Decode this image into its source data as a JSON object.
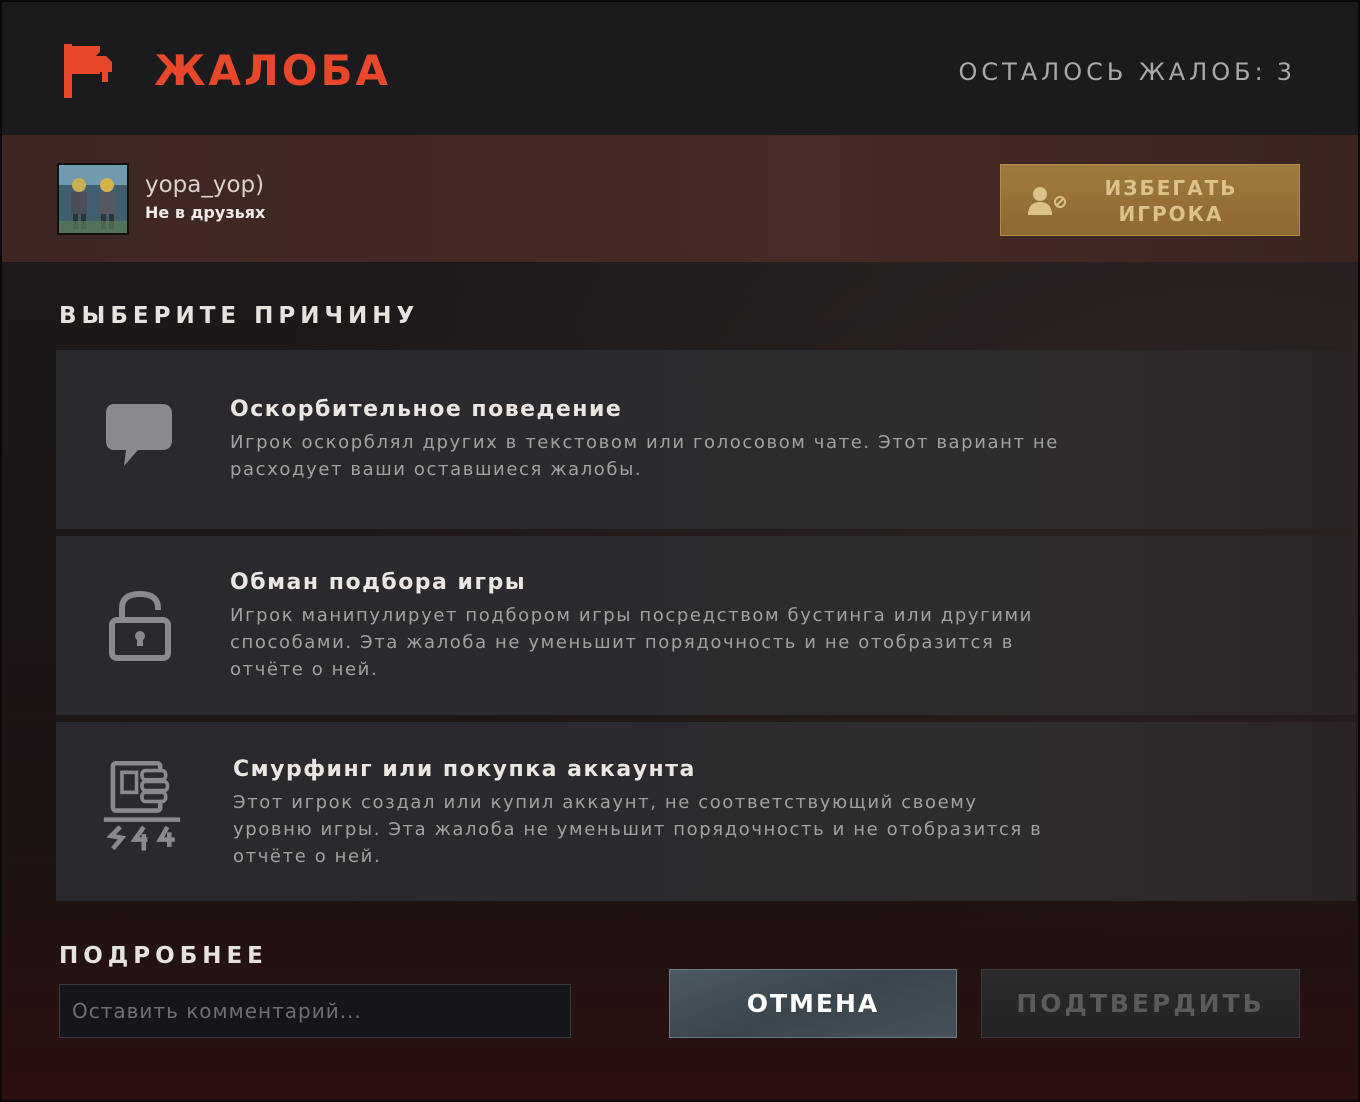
{
  "header": {
    "title": "ЖАЛОБА",
    "remaining_label": "ОСТАЛОСЬ ЖАЛОБ:",
    "remaining_count": "3",
    "flag_icon": "report-flag-icon",
    "accent_color": "#e8472a"
  },
  "player": {
    "name": "yopa_yop)",
    "status": "Не в друзьях",
    "avoid_button_line1": "ИЗБЕГАТЬ",
    "avoid_button_line2": "ИГРОКА",
    "avoid_icon": "avoid-player-icon"
  },
  "reasons_section": {
    "heading": "ВЫБЕРИТЕ ПРИЧИНУ",
    "reasons": [
      {
        "icon": "chat-bubble-icon",
        "title": "Оскорбительное поведение",
        "desc_line1": "Игрок оскорблял других в текстовом или голосовом чате. Этот вариант не",
        "desc_line2": "расходует ваши оставшиеся жалобы."
      },
      {
        "icon": "lock-icon",
        "title": "Обман подбора игры",
        "desc_line1": "Игрок манипулирует подбором игры посредством бустинга или другими",
        "desc_line2": "способами. Эта жалоба не уменьшит порядочность и не отобразится в",
        "desc_line3": "отчёте о ней."
      },
      {
        "icon": "account-purchase-icon",
        "title": "Смурфинг или покупка аккаунта",
        "desc_line1": "Этот игрок создал или купил аккаунт, не соответствующий своему",
        "desc_line2": "уровню игры. Эта жалоба не уменьшит порядочность и не отобразится в",
        "desc_line3": "отчёте о ней."
      }
    ]
  },
  "details": {
    "heading": "ПОДРОБНЕЕ",
    "comment_placeholder": "Оставить комментарий...",
    "comment_value": ""
  },
  "actions": {
    "cancel_label": "ОТМЕНА",
    "confirm_label": "ПОДТВЕРДИТЬ"
  }
}
